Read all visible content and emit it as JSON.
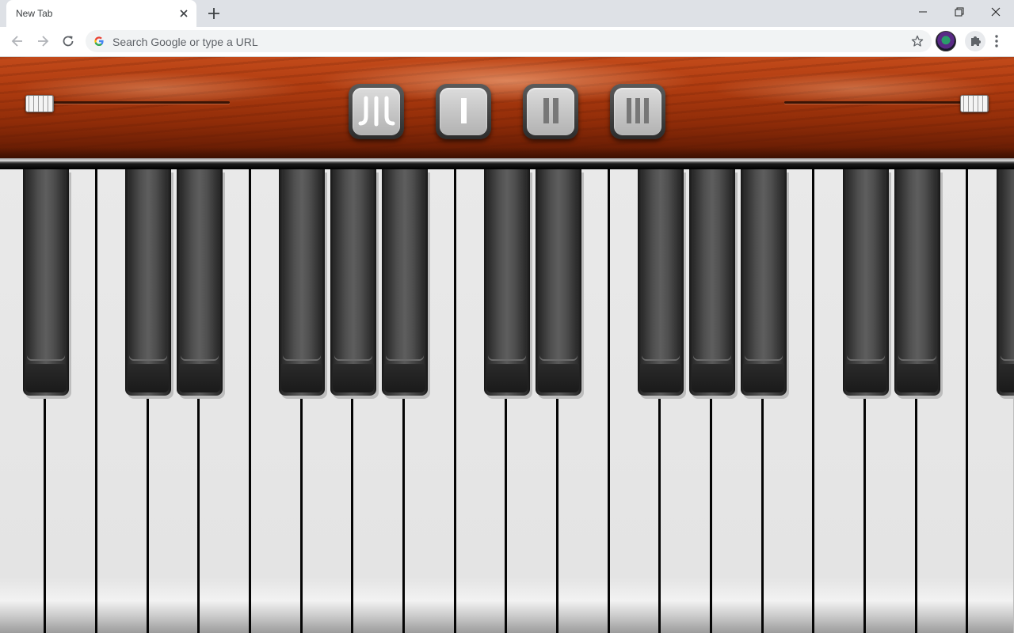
{
  "browser": {
    "tab_title": "New Tab",
    "omnibox_placeholder": "Search Google or type a URL"
  },
  "piano": {
    "mode_buttons": [
      {
        "name": "mode-auto-button",
        "glyph": "JIL"
      },
      {
        "name": "mode-1-button",
        "glyph": "I"
      },
      {
        "name": "mode-2-button",
        "glyph": "II"
      },
      {
        "name": "mode-3-button",
        "glyph": "III"
      }
    ],
    "left_slider_value": 0,
    "right_slider_value": 1,
    "white_key_count": 20,
    "visible_black_keys": 14
  }
}
